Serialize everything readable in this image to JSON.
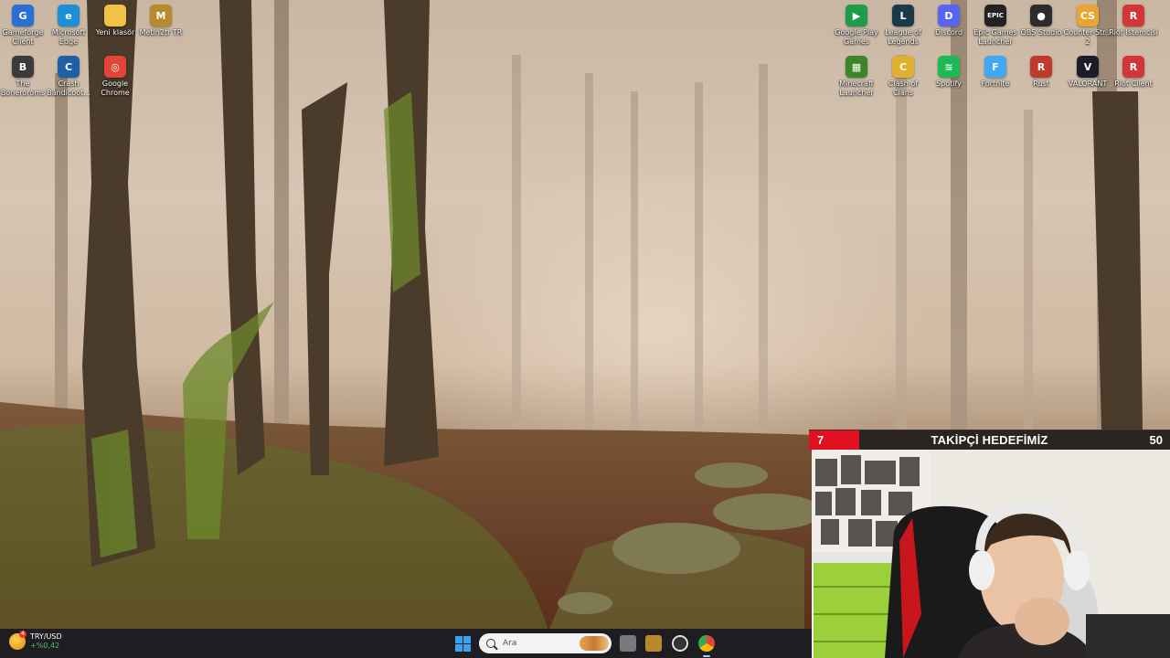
{
  "desktop": {
    "left_icons": [
      {
        "label": "Gameforge Client",
        "icon": "gameforge-icon",
        "color": "#2a6fd6",
        "glyph": "G"
      },
      {
        "label": "Microsoft Edge",
        "icon": "edge-icon",
        "color": "#1b8fd8",
        "glyph": "e"
      },
      {
        "label": "Yeni klasör",
        "icon": "folder-icon",
        "color": "#f2c244",
        "glyph": ""
      },
      {
        "label": "Metin2tr TR",
        "icon": "metin2-icon",
        "color": "#b88a2e",
        "glyph": "M"
      },
      {
        "label": "The Boneroroms",
        "icon": "boneroroms-icon",
        "color": "#3b3b3b",
        "glyph": "B"
      },
      {
        "label": "Crash Bandicoot...",
        "icon": "crash-icon",
        "color": "#1f5fa8",
        "glyph": "C"
      },
      {
        "label": "Google Chrome",
        "icon": "chrome-icon",
        "color": "#e54335",
        "glyph": "◎"
      }
    ],
    "right_icons": [
      {
        "label": "Google Play Games",
        "icon": "google-play-games-icon",
        "color": "#1d9c4a",
        "glyph": "▶"
      },
      {
        "label": "League of Legends",
        "icon": "league-icon",
        "color": "#1a3a4a",
        "glyph": "L"
      },
      {
        "label": "Discord",
        "icon": "discord-icon",
        "color": "#5865f2",
        "glyph": "D"
      },
      {
        "label": "Epic Games Launcher",
        "icon": "epic-icon",
        "color": "#222222",
        "glyph": "EPIC"
      },
      {
        "label": "OBS Studio",
        "icon": "obs-icon",
        "color": "#2c2c2c",
        "glyph": "●"
      },
      {
        "label": "Counter-Str... 2",
        "icon": "counter-strike-icon",
        "color": "#e8a531",
        "glyph": "CS"
      },
      {
        "label": "Riot İstemcisi",
        "icon": "riot-client-icon",
        "color": "#d13639",
        "glyph": "R"
      },
      {
        "label": "Minecraft Launcher",
        "icon": "minecraft-icon",
        "color": "#3c8527",
        "glyph": "▦"
      },
      {
        "label": "Clash of Clans",
        "icon": "clash-of-clans-icon",
        "color": "#e0b030",
        "glyph": "C"
      },
      {
        "label": "Spotify",
        "icon": "spotify-icon",
        "color": "#1db954",
        "glyph": "≋"
      },
      {
        "label": "Fortnite",
        "icon": "fortnite-icon",
        "color": "#3fa9f5",
        "glyph": "F"
      },
      {
        "label": "Rust",
        "icon": "rust-icon",
        "color": "#c0392b",
        "glyph": "R"
      },
      {
        "label": "VALORANT",
        "icon": "valorant-icon",
        "color": "#1c1c2a",
        "glyph": "V"
      },
      {
        "label": "Riot Client",
        "icon": "riot-client-icon",
        "color": "#d13639",
        "glyph": "R"
      }
    ]
  },
  "goal": {
    "start": "7",
    "title": "TAKİPÇİ HEDEFİMİZ",
    "end": "50",
    "progress_fraction": 0.14,
    "fill_color": "#e01020"
  },
  "taskbar": {
    "weather_title": "TRY/USD",
    "weather_value": "+%0,42",
    "weather_badge": "4",
    "search_placeholder": "Ara"
  }
}
